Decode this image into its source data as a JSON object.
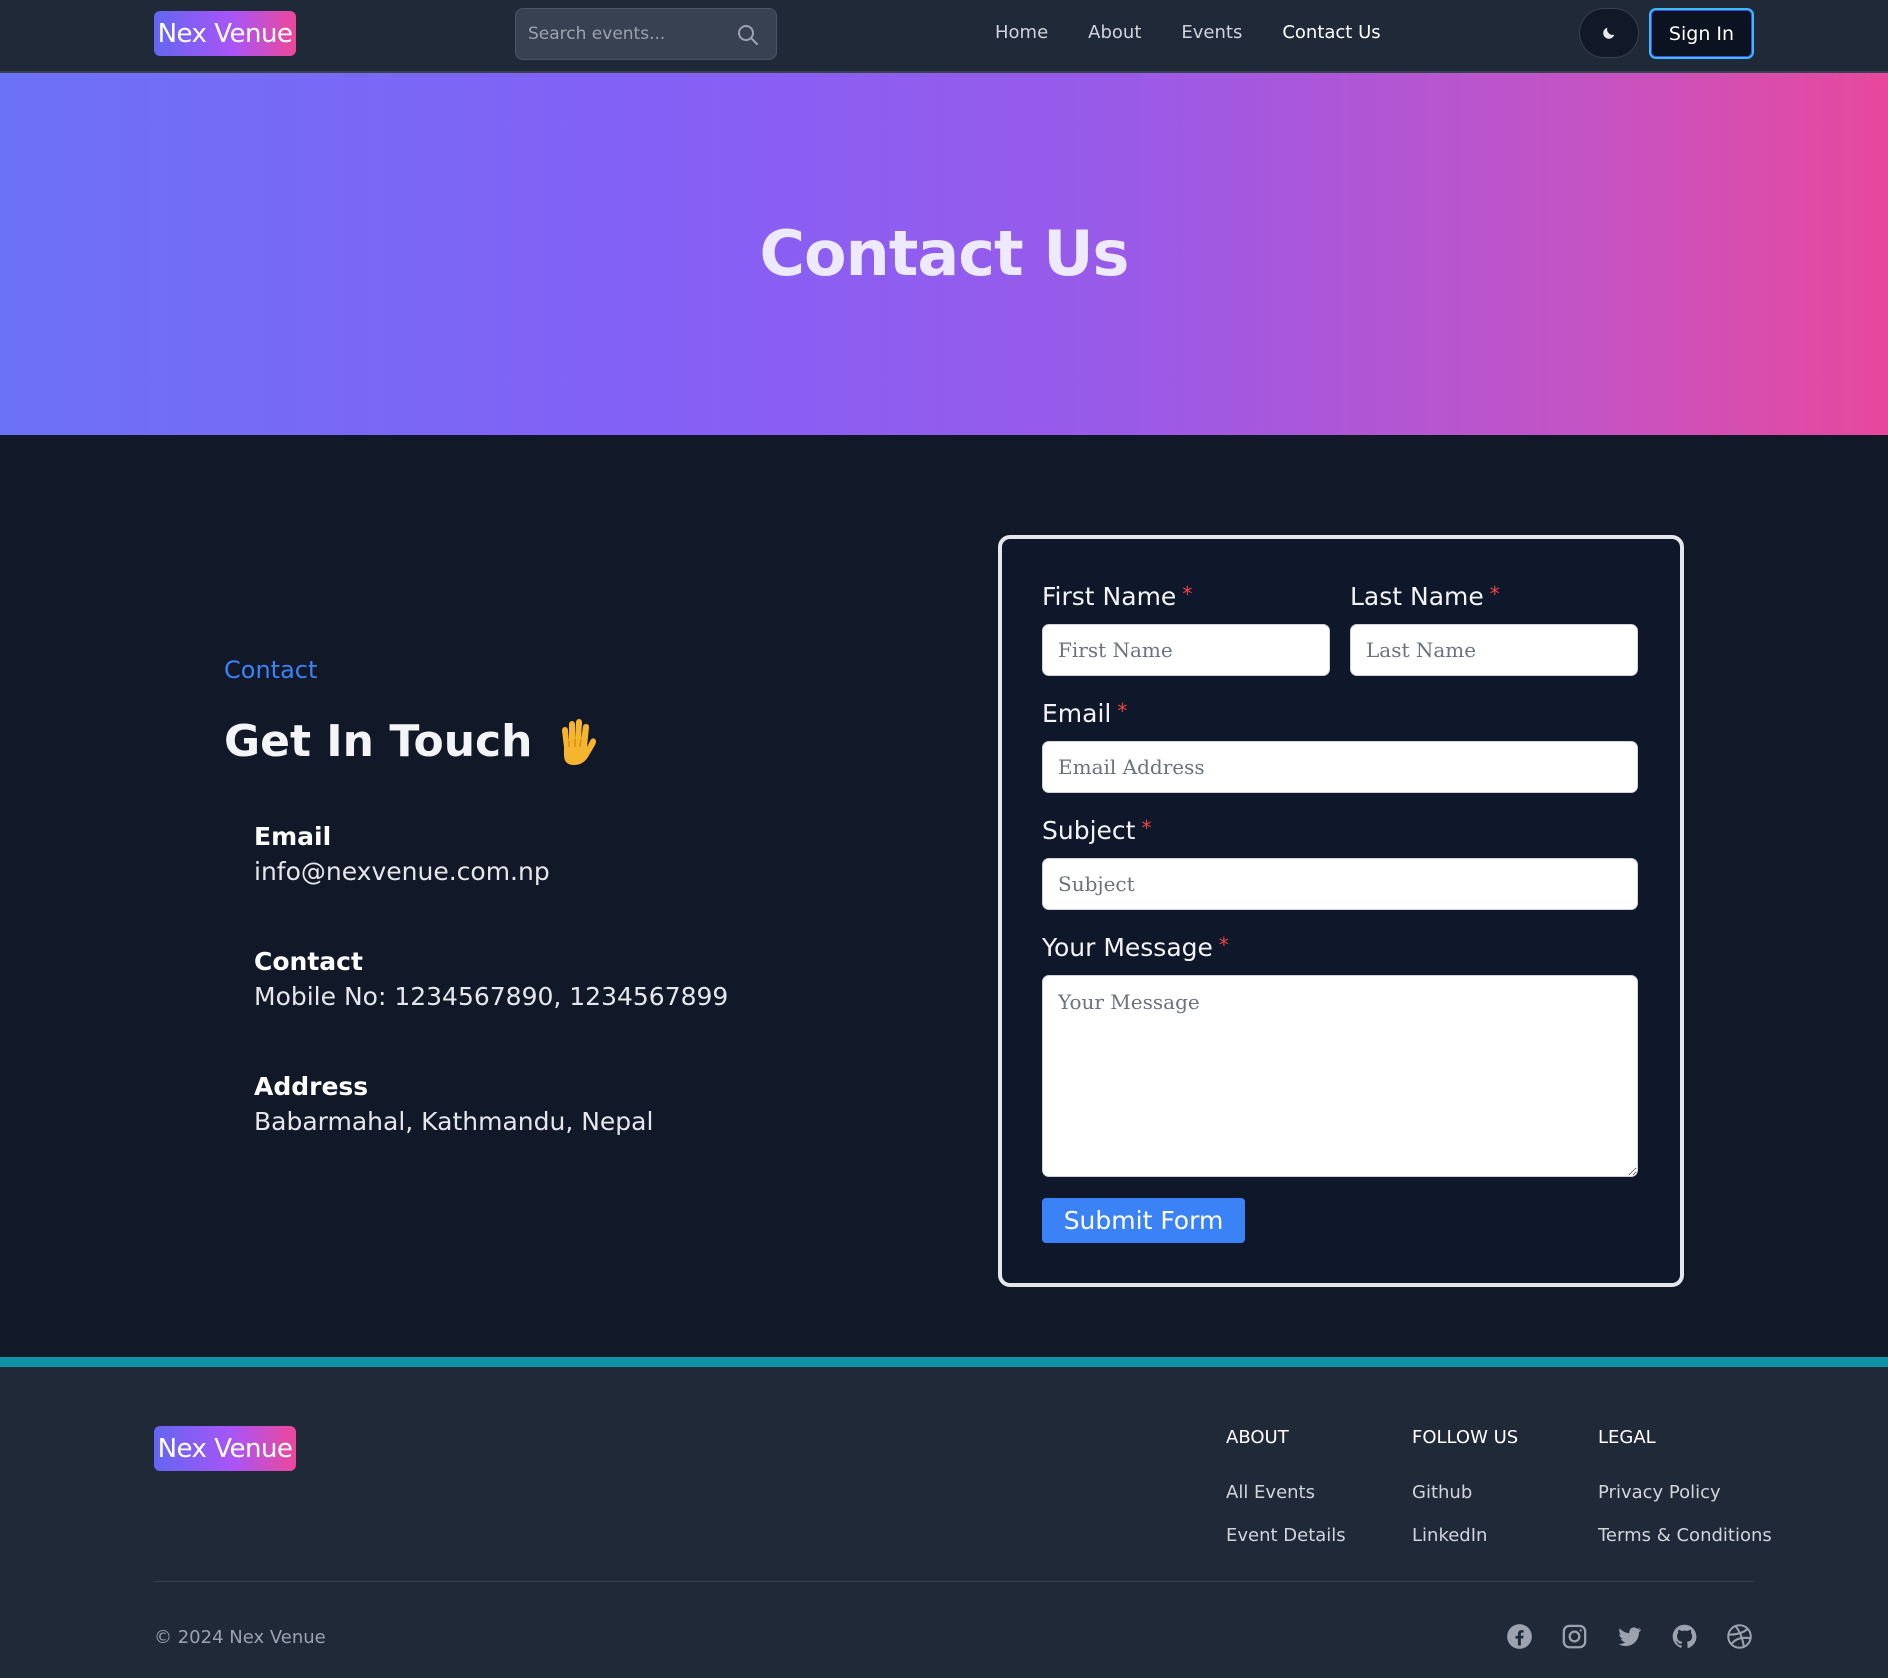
{
  "nav": {
    "logo": "Nex Venue",
    "search_placeholder": "Search events...",
    "links": [
      "Home",
      "About",
      "Events",
      "Contact Us"
    ],
    "active_link": "Contact Us",
    "signin": "Sign In"
  },
  "hero": {
    "title": "Contact Us"
  },
  "contact": {
    "eyebrow": "Contact",
    "title": "Get In Touch",
    "email_label": "Email",
    "email_value": "info@nexvenue.com.np",
    "phone_label": "Contact",
    "phone_value": "Mobile No: 1234567890, 1234567899",
    "address_label": "Address",
    "address_value": "Babarmahal, Kathmandu, Nepal"
  },
  "form": {
    "first_name_label": "First Name",
    "first_name_placeholder": "First Name",
    "last_name_label": "Last Name",
    "last_name_placeholder": "Last Name",
    "email_label": "Email",
    "email_placeholder": "Email Address",
    "subject_label": "Subject",
    "subject_placeholder": "Subject",
    "message_label": "Your Message",
    "message_placeholder": "Your Message",
    "required_mark": "*",
    "submit": "Submit Form"
  },
  "footer": {
    "logo": "Nex Venue",
    "about_heading": "ABOUT",
    "about_links": [
      "All Events",
      "Event Details"
    ],
    "follow_heading": "FOLLOW US",
    "follow_links": [
      "Github",
      "LinkedIn"
    ],
    "legal_heading": "LEGAL",
    "legal_links": [
      "Privacy Policy",
      "Terms & Conditions"
    ],
    "copyright": "© 2024 Nex Venue",
    "social_icons": [
      "facebook-icon",
      "instagram-icon",
      "twitter-icon",
      "github-icon",
      "dribbble-icon"
    ]
  },
  "colors": {
    "accent": "#3b82f6",
    "footer_border": "#0e94a6",
    "required": "#ef4444"
  }
}
